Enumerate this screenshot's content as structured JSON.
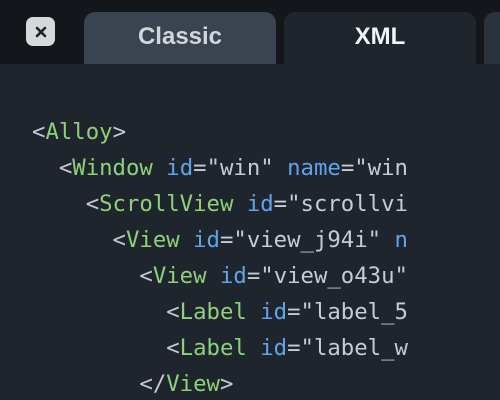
{
  "tabs": {
    "classic_label": "Classic",
    "xml_label": "XML",
    "active": "XML"
  },
  "icons": {
    "close": "close-icon"
  },
  "colors": {
    "background": "#1e252d",
    "tab_bar": "#13171c",
    "tab_inactive": "#3a4350",
    "tag": "#8fd17a",
    "attribute": "#5fa4ea",
    "text": "#c6ccd2"
  },
  "code": {
    "lines": [
      [
        {
          "t": "punc",
          "v": "<"
        },
        {
          "t": "tag",
          "v": "Alloy"
        },
        {
          "t": "punc",
          "v": ">"
        }
      ],
      [
        {
          "t": "punc",
          "v": "  <"
        },
        {
          "t": "tag",
          "v": "Window"
        },
        {
          "t": "punc",
          "v": " "
        },
        {
          "t": "attr",
          "v": "id"
        },
        {
          "t": "punc",
          "v": "="
        },
        {
          "t": "str",
          "v": "\"win\""
        },
        {
          "t": "punc",
          "v": " "
        },
        {
          "t": "attr",
          "v": "name"
        },
        {
          "t": "punc",
          "v": "="
        },
        {
          "t": "str",
          "v": "\"win"
        }
      ],
      [
        {
          "t": "punc",
          "v": "    <"
        },
        {
          "t": "tag",
          "v": "ScrollView"
        },
        {
          "t": "punc",
          "v": " "
        },
        {
          "t": "attr",
          "v": "id"
        },
        {
          "t": "punc",
          "v": "="
        },
        {
          "t": "str",
          "v": "\"scrollvi"
        }
      ],
      [
        {
          "t": "punc",
          "v": "      <"
        },
        {
          "t": "tag",
          "v": "View"
        },
        {
          "t": "punc",
          "v": " "
        },
        {
          "t": "attr",
          "v": "id"
        },
        {
          "t": "punc",
          "v": "="
        },
        {
          "t": "str",
          "v": "\"view_j94i\""
        },
        {
          "t": "punc",
          "v": " "
        },
        {
          "t": "attr",
          "v": "n"
        }
      ],
      [
        {
          "t": "punc",
          "v": "        <"
        },
        {
          "t": "tag",
          "v": "View"
        },
        {
          "t": "punc",
          "v": " "
        },
        {
          "t": "attr",
          "v": "id"
        },
        {
          "t": "punc",
          "v": "="
        },
        {
          "t": "str",
          "v": "\"view_o43u\""
        }
      ],
      [
        {
          "t": "punc",
          "v": "          <"
        },
        {
          "t": "tag",
          "v": "Label"
        },
        {
          "t": "punc",
          "v": " "
        },
        {
          "t": "attr",
          "v": "id"
        },
        {
          "t": "punc",
          "v": "="
        },
        {
          "t": "str",
          "v": "\"label_5"
        }
      ],
      [
        {
          "t": "punc",
          "v": "          <"
        },
        {
          "t": "tag",
          "v": "Label"
        },
        {
          "t": "punc",
          "v": " "
        },
        {
          "t": "attr",
          "v": "id"
        },
        {
          "t": "punc",
          "v": "="
        },
        {
          "t": "str",
          "v": "\"label_w"
        }
      ],
      [
        {
          "t": "punc",
          "v": "        </"
        },
        {
          "t": "tag",
          "v": "View"
        },
        {
          "t": "punc",
          "v": ">"
        }
      ]
    ]
  }
}
